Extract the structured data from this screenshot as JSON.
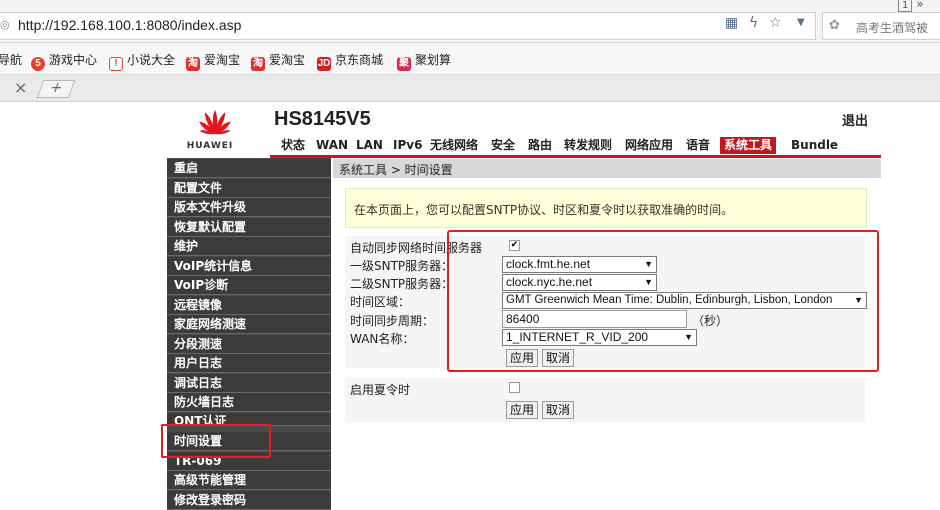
{
  "browser": {
    "url": "http://192.168.100.1:8080/index.asp",
    "top_right": "1",
    "search_placeholder": "高考生酒驾被",
    "bookmarks": [
      "导航",
      "游戏中心",
      "小说大全",
      "爱淘宝",
      "爱淘宝",
      "京东商城",
      "聚划算"
    ],
    "tab_close": "×",
    "tab_new": "+"
  },
  "router": {
    "brand": "HUAWEI",
    "model": "HS8145V5",
    "logout": "退出",
    "nav": [
      "状态",
      "WAN",
      "LAN",
      "IPv6",
      "无线网络",
      "安全",
      "路由",
      "转发规则",
      "网络应用",
      "语音",
      "系统工具",
      "Bundle"
    ],
    "active_nav": "系统工具",
    "sidebar": [
      "重启",
      "配置文件",
      "版本文件升级",
      "恢复默认配置",
      "维护",
      "VoIP统计信息",
      "VoIP诊断",
      "远程镜像",
      "家庭网络测速",
      "分段测速",
      "用户日志",
      "调试日志",
      "防火墙日志",
      "ONT认证",
      "时间设置",
      "TR-069",
      "高级节能管理",
      "修改登录密码"
    ],
    "active_sidebar": "时间设置",
    "breadcrumb": "系统工具 > 时间设置",
    "info": "在本页面上，您可以配置SNTP协议、时区和夏令时以获取准确的时间。",
    "form": {
      "auto_sync_label": "自动同步网络时间服务器",
      "auto_sync_checked": true,
      "sntp1_label": "一级SNTP服务器：",
      "sntp1_value": "clock.fmt.he.net",
      "sntp2_label": "二级SNTP服务器：",
      "sntp2_value": "clock.nyc.he.net",
      "timezone_label": "时间区域：",
      "timezone_value": "GMT Greenwich Mean Time: Dublin, Edinburgh, Lisbon, London",
      "period_label": "时间同步周期：",
      "period_value": "86400",
      "period_unit": "（秒）",
      "wan_label": "WAN名称：",
      "wan_value": "1_INTERNET_R_VID_200",
      "apply": "应用",
      "cancel": "取消"
    },
    "dst": {
      "label": "启用夏令时",
      "checked": false,
      "apply": "应用",
      "cancel": "取消"
    }
  },
  "colors": {
    "brand_red": "#c4171b",
    "highlight_red": "#e02020",
    "sidebar_bg": "#3b3b3b"
  }
}
